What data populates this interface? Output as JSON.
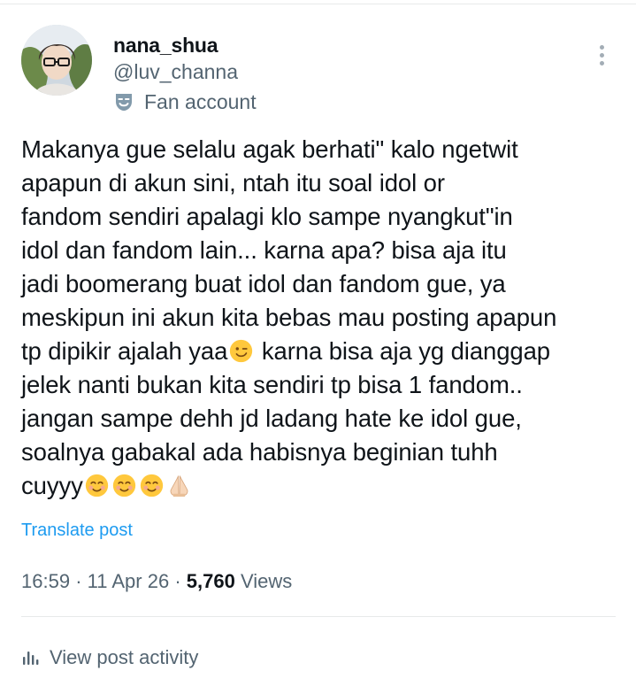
{
  "author": {
    "display_name": "nana_shua",
    "handle": "@luv_channa",
    "label": "Fan account",
    "avatar_icon": "profile-photo",
    "label_icon": "theater-mask-icon"
  },
  "post": {
    "lines": [
      "Makanya gue selalu agak berhati\" kalo ngetwit",
      "apapun di akun sini, ntah itu soal idol or",
      "fandom sendiri apalagi klo sampe nyangkut\"in",
      "idol dan fandom lain... karna apa? bisa aja itu",
      "jadi boomerang buat idol dan fandom gue, ya",
      "meskipun ini akun kita bebas mau posting apapun",
      "tp dipikir ajalah yaa",
      " karna bisa aja yg dianggap",
      "jelek nanti bukan kita sendiri tp bisa 1 fandom..",
      "jangan sampe dehh jd ladang hate ke idol gue,",
      "soalnya gabakal ada habisnya beginian tuhh",
      "cuyyy"
    ],
    "emojis": [
      "winking-face",
      "smiling-face",
      "smiling-face",
      "smiling-face",
      "folded-hands"
    ]
  },
  "translate_label": "Translate post",
  "meta": {
    "time": "16:59",
    "sep": "·",
    "date": "11 Apr 26",
    "views_count": "5,760",
    "views_label": "Views"
  },
  "activity": {
    "label": "View post activity",
    "icon": "analytics-bars-icon"
  },
  "colors": {
    "text": "#0f1419",
    "secondary": "#536471",
    "link": "#1d9bf0",
    "divider": "#e7e9ea"
  }
}
